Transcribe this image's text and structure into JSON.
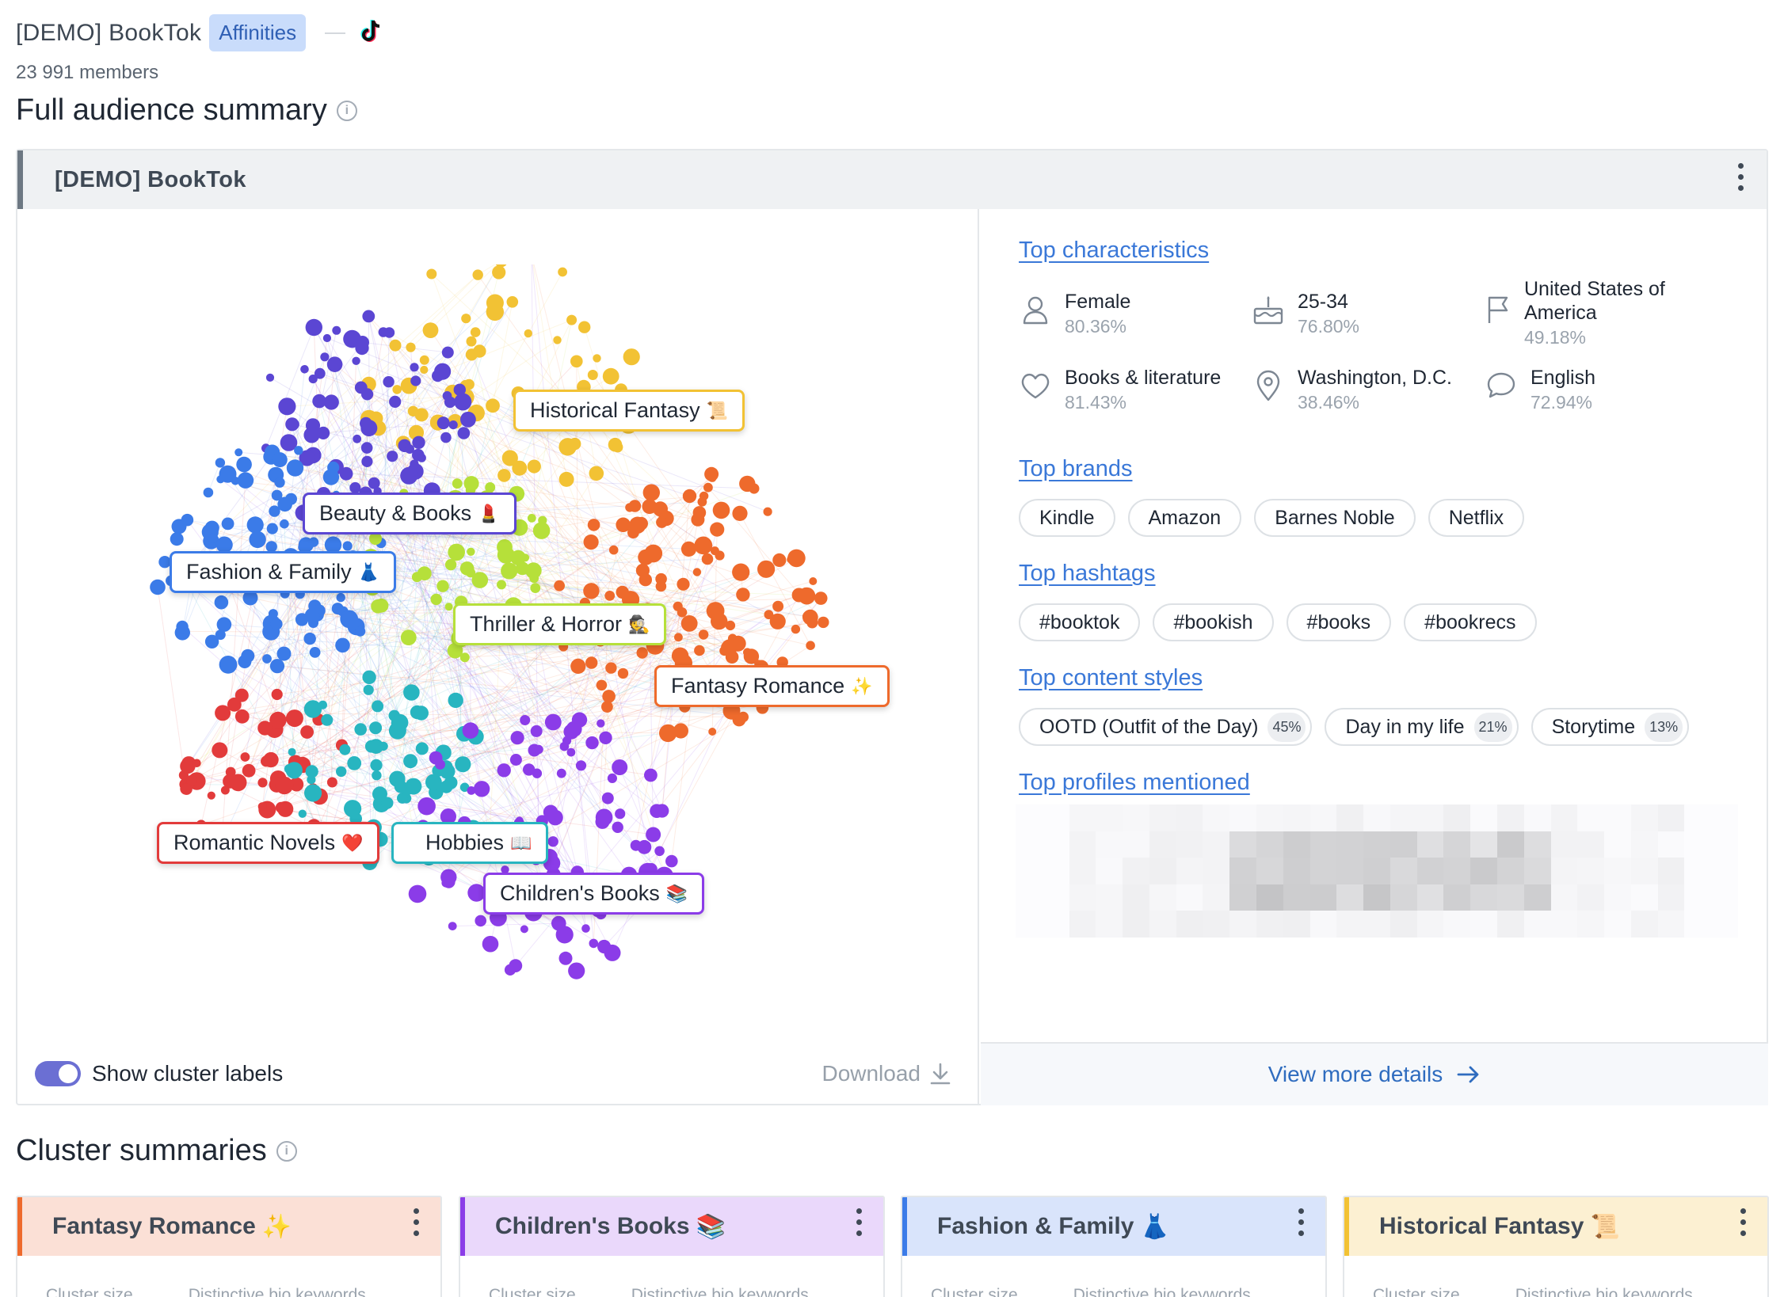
{
  "header": {
    "app_title": "[DEMO] BookTok",
    "badge": "Affinities",
    "platform_icon": "tiktok-icon",
    "members": "23 991 members"
  },
  "summary": {
    "title": "Full audience summary",
    "card_title": "[DEMO] BookTok",
    "clusters": [
      {
        "label": "Historical Fantasy",
        "emoji": "📜",
        "color": "#f2c234"
      },
      {
        "label": "Beauty & Books",
        "emoji": "💄",
        "color": "#5b46d3"
      },
      {
        "label": "Fashion & Family",
        "emoji": "👗",
        "color": "#3b7be8"
      },
      {
        "label": "Thriller & Horror",
        "emoji": "🕵",
        "color": "#b6e03a"
      },
      {
        "label": "Fantasy Romance",
        "emoji": "✨",
        "color": "#ee6a2c"
      },
      {
        "label": "Romantic Novels",
        "emoji": "❤️",
        "color": "#e23b3b"
      },
      {
        "label": "Hobbies",
        "emoji": "📖",
        "color": "#28b5c0"
      },
      {
        "label": "Children's Books",
        "emoji": "📚",
        "color": "#8b3ce8"
      }
    ],
    "toggle_label": "Show cluster labels",
    "toggle_on": true,
    "download_label": "Download"
  },
  "details": {
    "top_characteristics_title": "Top characteristics",
    "characteristics": [
      {
        "label": "Female",
        "value": "80.36%",
        "icon": "person-icon"
      },
      {
        "label": "25-34",
        "value": "76.80%",
        "icon": "cake-icon"
      },
      {
        "label": "United States of America",
        "value": "49.18%",
        "icon": "flag-icon"
      },
      {
        "label": "Books & literature",
        "value": "81.43%",
        "icon": "heart-icon"
      },
      {
        "label": "Washington, D.C.",
        "value": "38.46%",
        "icon": "location-pin-icon"
      },
      {
        "label": "English",
        "value": "72.94%",
        "icon": "speech-bubble-icon"
      }
    ],
    "top_brands_title": "Top brands",
    "brands": [
      "Kindle",
      "Amazon",
      "Barnes Noble",
      "Netflix"
    ],
    "top_hashtags_title": "Top hashtags",
    "hashtags": [
      "#booktok",
      "#bookish",
      "#books",
      "#bookrecs"
    ],
    "top_content_styles_title": "Top content styles",
    "content_styles": [
      {
        "label": "OOTD (Outfit of the Day)",
        "pct": "45%"
      },
      {
        "label": "Day in my life",
        "pct": "21%"
      },
      {
        "label": "Storytime",
        "pct": "13%"
      }
    ],
    "top_profiles_title": "Top profiles mentioned",
    "view_more": "View more details"
  },
  "cluster_summaries": {
    "title": "Cluster summaries",
    "cards": [
      {
        "title": "Fantasy Romance",
        "emoji": "✨",
        "accent": "#ee6a2c",
        "bg": "#fbe0d6"
      },
      {
        "title": "Children's Books",
        "emoji": "📚",
        "accent": "#8b3ce8",
        "bg": "#ead8fb"
      },
      {
        "title": "Fashion & Family",
        "emoji": "👗",
        "accent": "#3b7be8",
        "bg": "#d9e4fb"
      },
      {
        "title": "Historical Fantasy",
        "emoji": "📜",
        "accent": "#f2c234",
        "bg": "#fcf0d2"
      }
    ],
    "col_size": "Cluster size",
    "col_keywords": "Distinctive bio keywords"
  }
}
